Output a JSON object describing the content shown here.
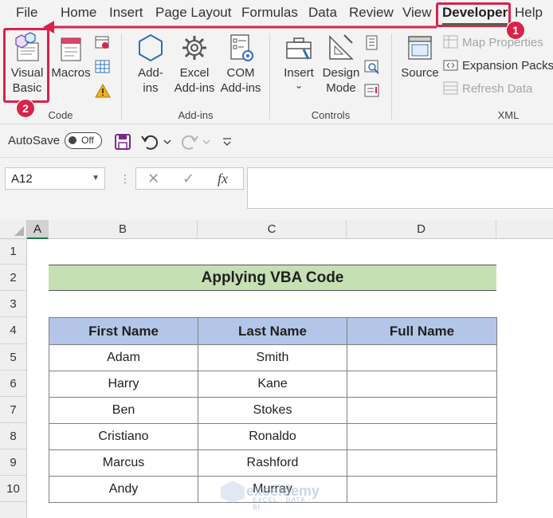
{
  "ribbon_tabs": [
    "File",
    "Home",
    "Insert",
    "Page Layout",
    "Formulas",
    "Data",
    "Review",
    "View",
    "Developer",
    "Help"
  ],
  "active_tab": "Developer",
  "groups": {
    "code": {
      "label": "Code",
      "visual_basic": [
        "Visual",
        "Basic"
      ],
      "macros": "Macros"
    },
    "addins": {
      "label": "Add-ins",
      "addins": [
        "Add-",
        "ins"
      ],
      "excel_addins": [
        "Excel",
        "Add-ins"
      ],
      "com_addins": [
        "COM",
        "Add-ins"
      ]
    },
    "controls": {
      "label": "Controls",
      "insert": "Insert",
      "insert_caret": "⌄",
      "design_mode": [
        "Design",
        "Mode"
      ]
    },
    "xml": {
      "label": "XML",
      "source": "Source",
      "map_properties": "Map Properties",
      "expansion_packs": "Expansion Packs",
      "refresh_data": "Refresh Data"
    }
  },
  "badges": {
    "developer_tab": "1",
    "visual_basic": "2"
  },
  "qat": {
    "autosave_label": "AutoSave",
    "autosave_state": "Off"
  },
  "formula_bar": {
    "name_box": "A12",
    "cancel_icon": "✕",
    "enter_icon": "✓",
    "fx_label": "fx",
    "formula": ""
  },
  "columns": [
    "A",
    "B",
    "C",
    "D"
  ],
  "rows": [
    "1",
    "2",
    "3",
    "4",
    "5",
    "6",
    "7",
    "8",
    "9",
    "10"
  ],
  "sheet": {
    "title": "Applying VBA Code",
    "headers": [
      "First Name",
      "Last Name",
      "Full Name"
    ],
    "records": [
      [
        "Adam",
        "Smith",
        ""
      ],
      [
        "Harry",
        "Kane",
        ""
      ],
      [
        "Ben",
        "Stokes",
        ""
      ],
      [
        "Cristiano",
        "Ronaldo",
        ""
      ],
      [
        "Marcus",
        "Rashford",
        ""
      ],
      [
        "Andy",
        "Murray",
        ""
      ]
    ]
  },
  "watermark": {
    "text": "exceldemy",
    "subtext": "EXCEL · DATA · BI"
  },
  "colors": {
    "accent": "#217346",
    "callout": "#d8234b",
    "title_fill": "#c6e0b4",
    "header_fill": "#b4c6e7"
  }
}
